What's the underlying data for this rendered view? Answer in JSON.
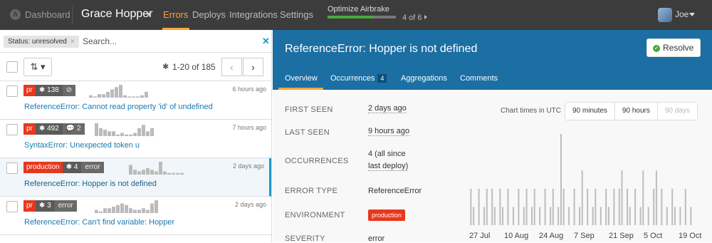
{
  "topbar": {
    "logo_text": "A",
    "dashboard_label": "Dashboard",
    "project": "Grace Hopper",
    "nav": [
      {
        "label": "Errors",
        "active": true
      },
      {
        "label": "Deploys",
        "active": false
      },
      {
        "label": "Integrations",
        "active": false
      },
      {
        "label": "Settings",
        "active": false
      }
    ],
    "optimize": {
      "label": "Optimize Airbrake",
      "step": "4 of 6",
      "progress": 0.67
    },
    "user": "Joe"
  },
  "list_panel": {
    "status_filter": "Status: unresolved",
    "search_placeholder": "Search...",
    "sort_icon": "sort-icon",
    "count": "1-20 of 185",
    "errors": [
      {
        "env": "pr",
        "count": "138",
        "extra": "",
        "extra_icon": "mute-icon",
        "time": "6 hours ago",
        "title": "ReferenceError: Cannot read property 'id' of undefined",
        "spark": [
          4,
          2,
          6,
          6,
          10,
          14,
          18,
          22,
          4,
          2,
          2,
          2,
          4,
          10
        ]
      },
      {
        "env": "pr",
        "count": "492",
        "extra": "2",
        "extra_icon": "comment-icon",
        "time": "7 hours ago",
        "title": "SyntaxError: Unexpected token u",
        "spark": [
          16,
          10,
          8,
          6,
          6,
          2,
          4,
          2,
          2,
          4,
          10,
          14,
          6,
          10
        ]
      },
      {
        "env": "production",
        "count": "4",
        "extra": "error",
        "extra_icon": "",
        "time": "2 days ago",
        "title": "ReferenceError: Hopper is not defined",
        "selected": true,
        "spark": [
          12,
          6,
          4,
          6,
          8,
          6,
          4,
          16,
          4,
          2,
          2,
          2,
          2
        ]
      },
      {
        "env": "pr",
        "count": "3",
        "extra": "error",
        "extra_icon": "",
        "time": "2 days ago",
        "title": "ReferenceError: Can't find variable: Hopper",
        "spark": [
          4,
          2,
          6,
          6,
          8,
          10,
          12,
          10,
          6,
          4,
          4,
          6,
          4,
          12,
          16
        ]
      }
    ]
  },
  "detail": {
    "title": "ReferenceError: Hopper is not defined",
    "resolve_label": "Resolve",
    "tabs": [
      {
        "label": "Overview",
        "active": true
      },
      {
        "label": "Occurrences",
        "badge": "4"
      },
      {
        "label": "Aggregations"
      },
      {
        "label": "Comments"
      }
    ],
    "fields": {
      "first_seen_label": "FIRST SEEN",
      "first_seen": "2 days ago",
      "last_seen_label": "LAST SEEN",
      "last_seen": "9 hours ago",
      "occurrences_label": "OCCURRENCES",
      "occurrences_line1": "4  (all since",
      "occurrences_line2": "last deploy)",
      "error_type_label": "ERROR TYPE",
      "error_type": "ReferenceError",
      "environment_label": "ENVIRONMENT",
      "environment": "production",
      "severity_label": "SEVERITY",
      "severity": "error"
    },
    "chart": {
      "label": "Chart times in UTC",
      "ranges": [
        "90 minutes",
        "90 hours",
        "90 days"
      ]
    }
  },
  "colors": {
    "accent": "#f9a43b",
    "header_blue": "#1b6fa3",
    "env_red": "#e8371e",
    "topbar": "#3c3c3c",
    "link": "#1a7ab0"
  },
  "chart_data": {
    "type": "bar",
    "title": "",
    "xlabel": "",
    "ylabel": "",
    "x_tick_labels": [
      "27 Jul",
      "10 Aug",
      "24 Aug",
      "7 Sep",
      "21 Sep",
      "5 Oct",
      "19 Oct"
    ],
    "values": [
      0,
      0,
      2,
      1,
      0,
      2,
      0,
      1,
      2,
      0,
      2,
      1,
      0,
      2,
      1,
      0,
      2,
      0,
      1,
      0,
      2,
      0,
      1,
      2,
      0,
      1,
      2,
      0,
      1,
      0,
      2,
      0,
      1,
      2,
      0,
      1,
      5,
      2,
      0,
      1,
      0,
      2,
      0,
      1,
      3,
      0,
      2,
      0,
      1,
      2,
      0,
      1,
      0,
      2,
      1,
      0,
      2,
      0,
      2,
      3,
      0,
      2,
      1,
      0,
      2,
      0,
      1,
      3,
      0,
      1,
      0,
      2,
      3,
      0,
      2,
      0,
      1,
      0,
      2,
      1,
      0,
      1,
      0,
      2,
      0,
      1
    ]
  }
}
